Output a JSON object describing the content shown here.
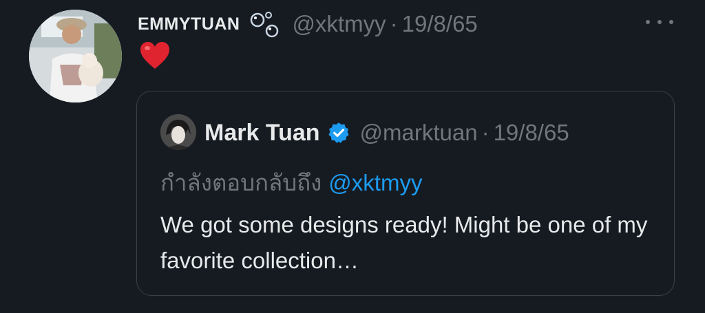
{
  "tweet": {
    "author_name": "EMMYTUAN",
    "author_emoji_icon": "bubbles-icon",
    "author_handle": "@xktmyy",
    "separator": "·",
    "date": "19/8/65",
    "content_icon": "red-heart-icon",
    "more_icon": "more-options-icon"
  },
  "quote": {
    "author_name": "Mark Tuan",
    "verified_icon": "verified-badge-icon",
    "author_handle": "@marktuan",
    "separator": "·",
    "date": "19/8/65",
    "reply_prefix": "กำลังตอบกลับถึง",
    "reply_mention": "@xktmyy",
    "text": "We got some designs ready! Might be one of my favorite collection…"
  },
  "colors": {
    "background": "#161b22",
    "primary_text": "#e7e9ea",
    "secondary_text": "#71767b",
    "link": "#1d9bf0",
    "border": "#3a4048",
    "heart": "#e0242f"
  }
}
